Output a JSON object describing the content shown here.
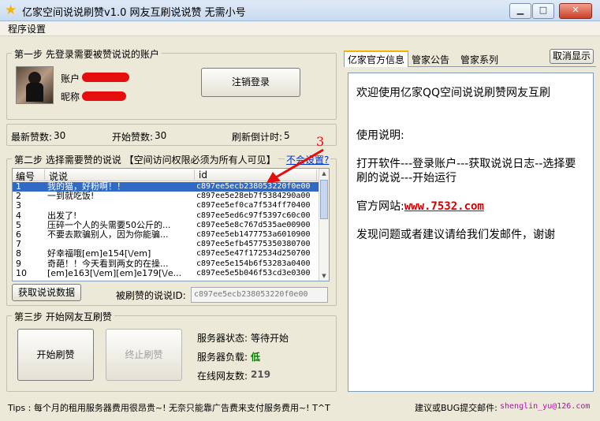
{
  "window": {
    "title": "亿家空间说说刷赞v1.0 网友互刷说说赞 无需小号"
  },
  "menu": {
    "settings": "程序设置"
  },
  "step1": {
    "title": "第一步 先登录需要被赞说说的账户",
    "account_label": "账户",
    "nickname_label": "昵称",
    "logout_button": "注销登录"
  },
  "stats": {
    "latest_label": "最新赞数:",
    "latest_value": "30",
    "start_label": "开始赞数:",
    "start_value": "30",
    "countdown_label": "刷新倒计时:",
    "countdown_value": "5"
  },
  "step2": {
    "title": "第二步 选择需要赞的说说 【空间访问权限必须为所有人可见】",
    "settings_link": "不会设置?",
    "columns": [
      "编号",
      "说说",
      "id"
    ],
    "rows": [
      [
        "1",
        "我的猫，好粉啊！！",
        "c897ee5ecb238053220f0e00"
      ],
      [
        "2",
        "一到就吃饭!",
        "c897ee5e28eb7f5384290a00"
      ],
      [
        "3",
        "",
        "c897ee5ef0ca7f534ff70400"
      ],
      [
        "4",
        "出发了!",
        "c897ee5ed6c97f5397c60c00"
      ],
      [
        "5",
        "压碎一个人的头需要50公斤的...",
        "c897ee5e8c767d535ae00900"
      ],
      [
        "6",
        "不要去欺骗别人，因为你能骗...",
        "c897ee5eb1477753a6010900"
      ],
      [
        "7",
        "",
        "c897ee5efb45775350380700"
      ],
      [
        "8",
        "好幸福哦[em]e154[\\/em]",
        "c897ee5e47f172534d250700"
      ],
      [
        "9",
        "奇葩！！今天看到两女的在操...",
        "c897ee5e154b6f53283a0400"
      ],
      [
        "10",
        "[em]e163[\\/em][em]e179[\\/e...",
        "c897ee5e5b046f53cd3e0300"
      ]
    ],
    "fetch_button": "获取说说数据",
    "selected_label": "被刷赞的说说ID:",
    "selected_id": "c897ee5ecb238053220f0e00",
    "annotation": "3"
  },
  "step3": {
    "title": "第三步 开始网友互刷赞",
    "start_button": "开始刷赞",
    "stop_button": "终止刷赞",
    "server_status_label": "服务器状态:",
    "server_status_value": "等待开始",
    "server_load_label": "服务器负载:",
    "server_load_value": "低",
    "online_label": "在线网友数:",
    "online_value": "219"
  },
  "right": {
    "tabs": [
      "亿家官方信息",
      "管家公告",
      "管家系列"
    ],
    "hide_button": "取消显示",
    "welcome": "欢迎使用亿家QQ空间说说刷赞网友互刷",
    "usage_title": "使用说明:",
    "usage": "打开软件---登录账户---获取说说日志--选择要刷的说说---开始运行",
    "site_label": "官方网站:",
    "site_url": "www.7532.com",
    "feedback": "发现问题或者建议请给我们发邮件，谢谢"
  },
  "footer": {
    "tips": "Tips : 每个月的租用服务器费用很昂贵~! 无奈只能靠广告费来支付服务费用~! T^T",
    "contact_label": "建议或BUG提交邮件:",
    "contact_email": "shenglin_yu@126.com"
  },
  "colors": {
    "selection": "#316ac5",
    "accent": "#e50d0d",
    "load_ok": "#008000"
  }
}
